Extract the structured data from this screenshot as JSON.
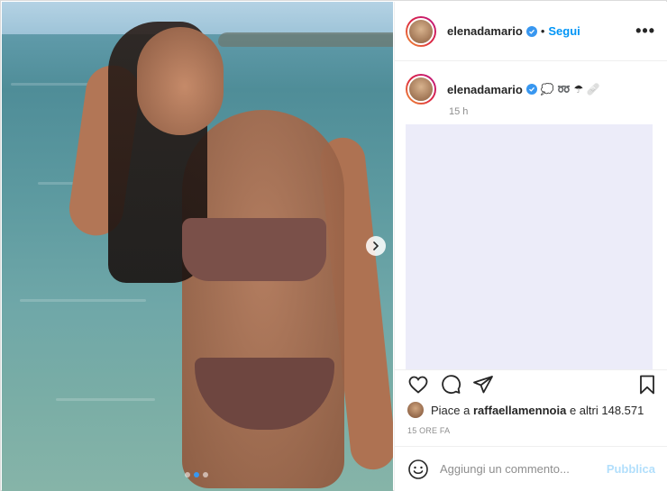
{
  "post": {
    "username": "elenadamario",
    "follow_label": "Segui",
    "separator": "•",
    "more_label": "•••",
    "caption_emojis": "💭 ➿ ☂ 🩹",
    "relative_time": "15 h",
    "likes_prefix": "Piace a",
    "likes_user": "raffaellamennoia",
    "likes_suffix": "e altri 148.571",
    "date_label": "15 ORE FA",
    "comment_placeholder": "Aggiungi un commento...",
    "publish_label": "Pubblica"
  },
  "carousel": {
    "current_index": 1,
    "total": 3
  },
  "icons": {
    "next": "chevron-right-icon",
    "verified": "verified-badge-icon",
    "like": "heart-icon",
    "comment": "comment-icon",
    "share": "paper-plane-icon",
    "save": "bookmark-icon",
    "emoji": "smiley-icon"
  },
  "colors": {
    "accent": "#0095f6",
    "verified": "#3897f0",
    "muted": "#8e8e8e",
    "publish_disabled": "#b2dffc"
  }
}
